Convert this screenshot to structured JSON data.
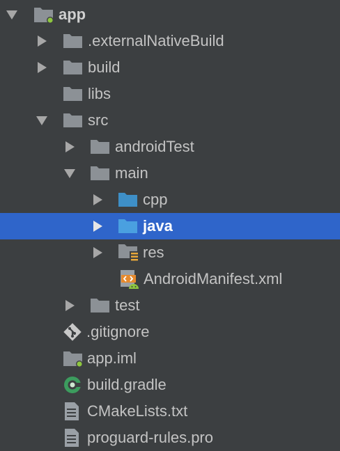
{
  "project_tree": {
    "items": [
      {
        "label": "app",
        "icon": "module-folder-icon"
      },
      {
        "label": ".externalNativeBuild",
        "icon": "folder-icon"
      },
      {
        "label": "build",
        "icon": "folder-icon"
      },
      {
        "label": "libs",
        "icon": "folder-icon"
      },
      {
        "label": "src",
        "icon": "folder-icon"
      },
      {
        "label": "androidTest",
        "icon": "folder-icon"
      },
      {
        "label": "main",
        "icon": "folder-icon"
      },
      {
        "label": "cpp",
        "icon": "source-folder-icon"
      },
      {
        "label": "java",
        "icon": "source-folder-icon"
      },
      {
        "label": "res",
        "icon": "resource-folder-icon"
      },
      {
        "label": "AndroidManifest.xml",
        "icon": "android-manifest-icon"
      },
      {
        "label": "test",
        "icon": "folder-icon"
      },
      {
        "label": ".gitignore",
        "icon": "git-icon"
      },
      {
        "label": "app.iml",
        "icon": "iml-file-icon"
      },
      {
        "label": "build.gradle",
        "icon": "gradle-icon"
      },
      {
        "label": "CMakeLists.txt",
        "icon": "text-file-icon"
      },
      {
        "label": "proguard-rules.pro",
        "icon": "text-file-icon"
      }
    ]
  },
  "colors": {
    "background": "#3c3f41",
    "selection": "#2f65ca",
    "folder": "#8c9196",
    "source_folder": "#3e8fc7",
    "text": "#bbbbbb"
  }
}
